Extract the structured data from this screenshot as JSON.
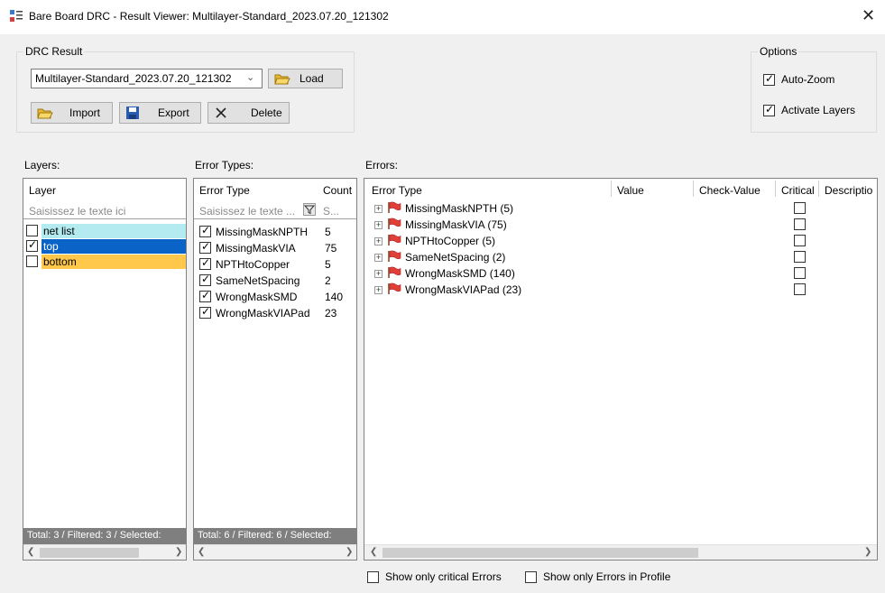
{
  "window": {
    "title": "Bare Board DRC - Result Viewer: Multilayer-Standard_2023.07.20_121302",
    "close_glyph": "✕"
  },
  "drc_result": {
    "group_label": "DRC Result",
    "selected": "Multilayer-Standard_2023.07.20_121302",
    "load_label": "Load",
    "import_label": "Import",
    "export_label": "Export",
    "delete_label": "Delete"
  },
  "options": {
    "group_label": "Options",
    "auto_zoom_label": "Auto-Zoom",
    "auto_zoom_checked": true,
    "activate_layers_label": "Activate Layers",
    "activate_layers_checked": true
  },
  "layers": {
    "panel_label": "Layers:",
    "header": "Layer",
    "filter_placeholder": "Saisissez le texte ici",
    "items": [
      {
        "name": "net list",
        "checked": false,
        "color": "#b3ebf0"
      },
      {
        "name": "top",
        "checked": true,
        "color": "#0a64c8"
      },
      {
        "name": "bottom",
        "checked": false,
        "color": "#ffc84b"
      }
    ],
    "status": "Total: 3 / Filtered: 3 / Selected:"
  },
  "error_types": {
    "panel_label": "Error Types:",
    "header_type": "Error Type",
    "header_count": "Count",
    "filter_placeholder": "Saisissez le texte ...",
    "count_filter_placeholder": "S...",
    "items": [
      {
        "name": "MissingMaskNPTH",
        "count": "5",
        "checked": true
      },
      {
        "name": "MissingMaskVIA",
        "count": "75",
        "checked": true
      },
      {
        "name": "NPTHtoCopper",
        "count": "5",
        "checked": true
      },
      {
        "name": "SameNetSpacing",
        "count": "2",
        "checked": true
      },
      {
        "name": "WrongMaskSMD",
        "count": "140",
        "checked": true
      },
      {
        "name": "WrongMaskVIAPad",
        "count": "23",
        "checked": true
      }
    ],
    "status": "Total: 6 / Filtered: 6 / Selected:"
  },
  "errors": {
    "panel_label": "Errors:",
    "columns": [
      "Error Type",
      "Value",
      "Check-Value",
      "Critical",
      "Descriptio"
    ],
    "rows": [
      {
        "label": "MissingMaskNPTH (5)",
        "critical": false
      },
      {
        "label": "MissingMaskVIA (75)",
        "critical": false
      },
      {
        "label": "NPTHtoCopper (5)",
        "critical": false
      },
      {
        "label": "SameNetSpacing (2)",
        "critical": false
      },
      {
        "label": "WrongMaskSMD (140)",
        "critical": false
      },
      {
        "label": "WrongMaskVIAPad (23)",
        "critical": false
      }
    ]
  },
  "footer": {
    "critical_only_label": "Show only critical Errors",
    "critical_only_checked": false,
    "profile_only_label": "Show only Errors in Profile",
    "profile_only_checked": false
  },
  "colors": {
    "accent": "#0a64c8",
    "flag": "#e0403a"
  }
}
